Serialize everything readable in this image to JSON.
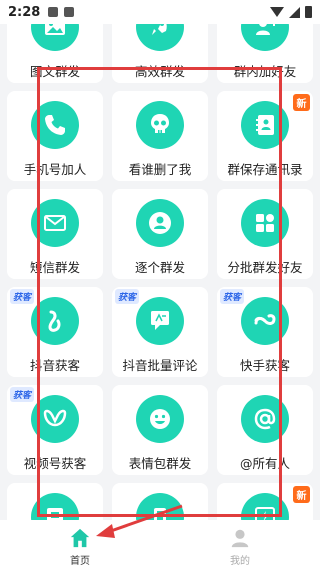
{
  "status_bar": {
    "time": "2:28"
  },
  "features": [
    {
      "label": "图文群发",
      "icon": "image-icon",
      "badge": ""
    },
    {
      "label": "高效群发",
      "icon": "rocket-icon",
      "badge": ""
    },
    {
      "label": "群内加好友",
      "icon": "user-plus-icon",
      "badge": ""
    },
    {
      "label": "手机号加人",
      "icon": "phone-icon",
      "badge": ""
    },
    {
      "label": "看谁删了我",
      "icon": "skull-icon",
      "badge": ""
    },
    {
      "label": "群保存通讯录",
      "icon": "contacts-book-icon",
      "badge": "新"
    },
    {
      "label": "短信群发",
      "icon": "mail-icon",
      "badge": ""
    },
    {
      "label": "逐个群发",
      "icon": "person-icon",
      "badge": ""
    },
    {
      "label": "分批群发好友",
      "icon": "grid-apps-icon",
      "badge": ""
    },
    {
      "label": "抖音获客",
      "icon": "douyin-icon",
      "badge": "获客"
    },
    {
      "label": "抖音批量评论",
      "icon": "comment-icon",
      "badge": "获客"
    },
    {
      "label": "快手获客",
      "icon": "kuaishou-icon",
      "badge": "获客"
    },
    {
      "label": "视频号获客",
      "icon": "channels-butterfly-icon",
      "badge": "获客"
    },
    {
      "label": "表情包群发",
      "icon": "smiley-icon",
      "badge": ""
    },
    {
      "label": "@所有人",
      "icon": "at-sign-icon",
      "badge": ""
    },
    {
      "label": "",
      "icon": "stamp-icon",
      "badge": ""
    },
    {
      "label": "",
      "icon": "mirror-icon",
      "badge": ""
    },
    {
      "label": "",
      "icon": "lightning-icon",
      "badge": "新"
    }
  ],
  "tabbar": {
    "home": "首页",
    "mine": "我的"
  },
  "colors": {
    "accent": "#1fd5b4",
    "highlight": "#e03d3d",
    "new_badge": "#ff6b1a",
    "huoke_badge": "#2d66e8"
  }
}
